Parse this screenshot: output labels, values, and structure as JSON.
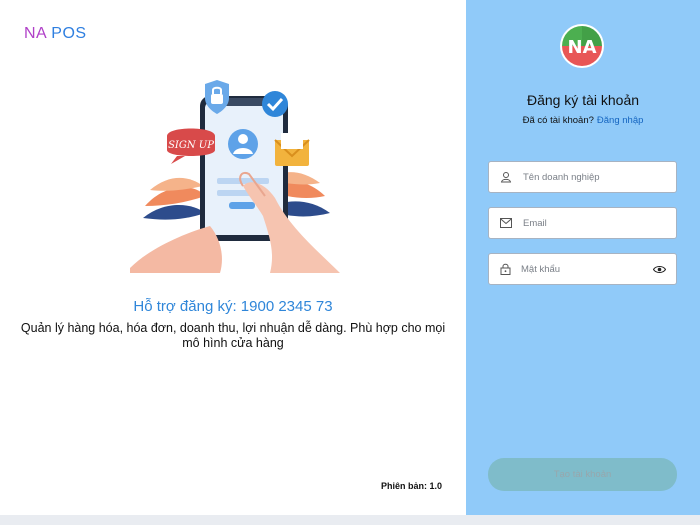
{
  "brand": {
    "na": "NA",
    "pos": "POS"
  },
  "illustration": {
    "sign_text": "SIGN UP"
  },
  "support": {
    "text": "Hỗ trợ đăng ký: 1900 2345 73"
  },
  "description": {
    "text": "Quản lý hàng hóa, hóa đơn, doanh thu, lợi nhuận dễ dàng. Phù hợp cho mọi mô hình cửa hàng"
  },
  "version": {
    "text": "Phiên bản: 1.0"
  },
  "logo": {
    "text": "NA"
  },
  "register": {
    "title": "Đăng ký tài khoản",
    "have_account": "Đã có tài khoản?",
    "login_link": "Đăng nhập",
    "fields": {
      "business": {
        "placeholder": "Tên doanh nghiệp",
        "icon": "person-icon"
      },
      "email": {
        "placeholder": "Email",
        "icon": "mail-icon"
      },
      "password": {
        "placeholder": "Mật khẩu",
        "icon": "lock-icon",
        "toggle_icon": "eye-icon"
      }
    },
    "submit_label": "Tạo tài khoản"
  },
  "colors": {
    "right_panel": "#90caf9",
    "brand_na": "#b040c8",
    "brand_pos": "#2f7fe0",
    "support_text": "#2f86d9",
    "link": "#1565c0",
    "button_disabled": "#7fbcca"
  }
}
